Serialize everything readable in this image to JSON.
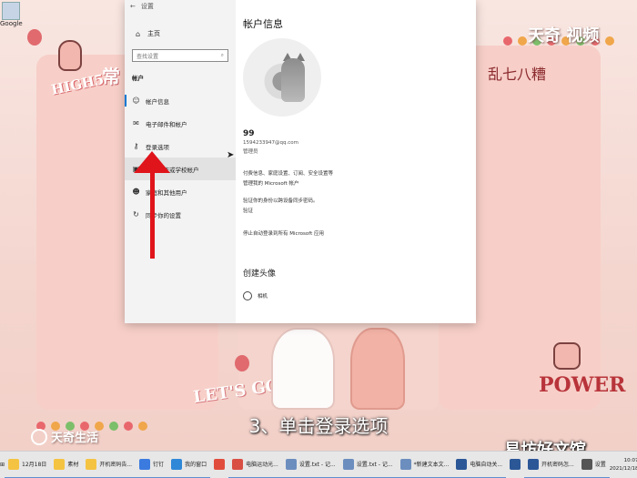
{
  "settings": {
    "titlebar": {
      "title": "设置"
    },
    "sidebar": {
      "home_label": "主页",
      "search_placeholder": "查找设置",
      "section_label": "帐户",
      "items": [
        {
          "label": "帐户信息",
          "icon": "person-icon"
        },
        {
          "label": "电子邮件和帐户",
          "icon": "mail-icon"
        },
        {
          "label": "登录选项",
          "icon": "key-icon"
        },
        {
          "label": "连接工作或学校帐户",
          "icon": "briefcase-icon"
        },
        {
          "label": "家庭和其他用户",
          "icon": "people-icon"
        },
        {
          "label": "同步你的设置",
          "icon": "sync-icon"
        }
      ]
    },
    "content": {
      "title": "帐户信息",
      "user_name": "99",
      "user_email": "1594233947@qq.com",
      "user_role": "管理员",
      "billing_line": "付费信息、家庭设置、订阅、安全设置等",
      "manage_link": "管理我的 Microsoft 帐户",
      "verify_line": "验证你的身份以跨设备同步密码。",
      "verify_link": "验证",
      "stop_signin_link": "停止自动登录到所有 Microsoft 应用",
      "create_avatar_title": "创建头像",
      "camera_label": "相机"
    }
  },
  "wallpaper": {
    "high5": "HIGH5",
    "chang": "常",
    "luanqibazao": "乱七八糟",
    "lets_go": "LET'S GO!!!",
    "power": "POWER",
    "dot_colors": [
      "#e8676c",
      "#f0a64a",
      "#7cbf6a",
      "#e8676c",
      "#f0a64a",
      "#7cbf6a",
      "#e8676c",
      "#f0a64a"
    ]
  },
  "watermarks": {
    "top_right": "天奇 视频",
    "bottom_left": "天奇生活",
    "bottom_right": "易坊好文馆"
  },
  "caption": "3、单击登录选项",
  "taskbar": {
    "items": [
      {
        "label": "12月18日",
        "color": "#f5c342"
      },
      {
        "label": "素材",
        "color": "#f5c342"
      },
      {
        "label": "开机密码告...",
        "color": "#f5c342"
      },
      {
        "label": "钉钉",
        "color": "#3b7be0"
      },
      {
        "label": "我的窗口",
        "color": "#2f87d8"
      },
      {
        "label": "",
        "color": "#e14d3c"
      },
      {
        "label": "电脑运动光...",
        "color": "#d94f44"
      },
      {
        "label": "设置.txt - 记...",
        "color": "#6c8ebf"
      },
      {
        "label": "设置.txt - 记...",
        "color": "#6c8ebf"
      },
      {
        "label": "*新建文本文...",
        "color": "#6c8ebf"
      },
      {
        "label": "电脑自动关...",
        "color": "#2b5797"
      },
      {
        "label": "",
        "color": "#2b5797"
      },
      {
        "label": "开机密码怎...",
        "color": "#2b5797"
      },
      {
        "label": "设置",
        "color": "#555555"
      }
    ],
    "time": "10:07",
    "date": "2021/12/18"
  },
  "desktop": {
    "icon_label": "Google"
  }
}
